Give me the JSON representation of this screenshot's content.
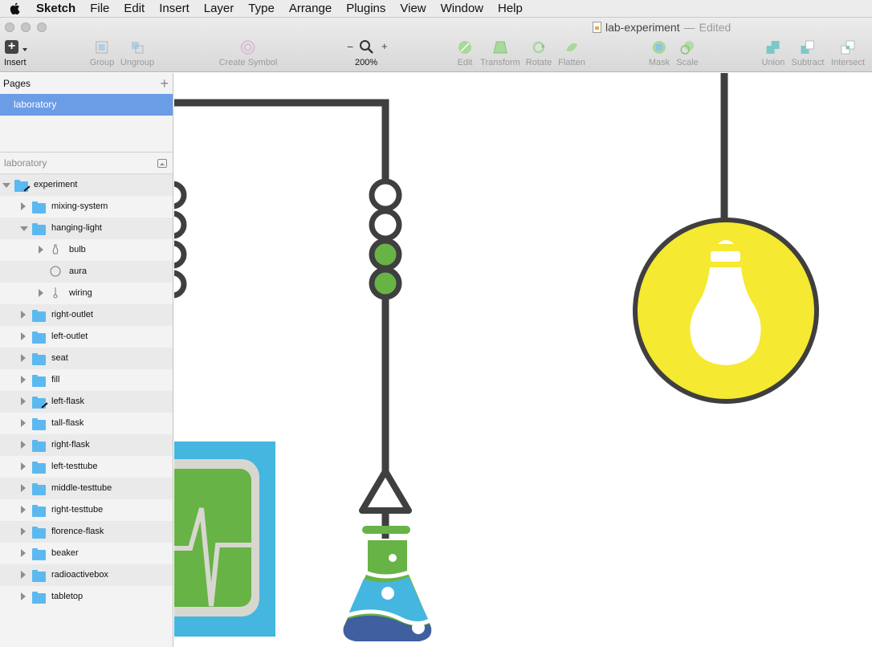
{
  "menubar": {
    "app_name": "Sketch",
    "items": [
      "File",
      "Edit",
      "Insert",
      "Layer",
      "Type",
      "Arrange",
      "Plugins",
      "View",
      "Window",
      "Help"
    ]
  },
  "window": {
    "doc_name": "lab-experiment",
    "separator": "—",
    "status": "Edited"
  },
  "toolbar": {
    "insert_label": "Insert",
    "group_label": "Group",
    "ungroup_label": "Ungroup",
    "create_symbol_label": "Create Symbol",
    "zoom_minus": "−",
    "zoom_plus": "+",
    "zoom_level": "200%",
    "edit_label": "Edit",
    "transform_label": "Transform",
    "rotate_label": "Rotate",
    "flatten_label": "Flatten",
    "mask_label": "Mask",
    "scale_label": "Scale",
    "union_label": "Union",
    "subtract_label": "Subtract",
    "intersect_label": "Intersect"
  },
  "pages": {
    "header": "Pages",
    "add": "+",
    "items": [
      "laboratory"
    ]
  },
  "layers": {
    "header": "laboratory",
    "items": [
      {
        "label": "experiment",
        "depth": 0,
        "expanded": true,
        "icon": "folder-masked"
      },
      {
        "label": "mixing-system",
        "depth": 1,
        "expanded": false,
        "icon": "folder"
      },
      {
        "label": "hanging-light",
        "depth": 1,
        "expanded": true,
        "icon": "folder"
      },
      {
        "label": "bulb",
        "depth": 2,
        "expanded": false,
        "icon": "bulb-shape"
      },
      {
        "label": "aura",
        "depth": 2,
        "expanded": null,
        "icon": "oval"
      },
      {
        "label": "wiring",
        "depth": 2,
        "expanded": false,
        "icon": "wiring-shape"
      },
      {
        "label": "right-outlet",
        "depth": 1,
        "expanded": false,
        "icon": "folder"
      },
      {
        "label": "left-outlet",
        "depth": 1,
        "expanded": false,
        "icon": "folder"
      },
      {
        "label": "seat",
        "depth": 1,
        "expanded": false,
        "icon": "folder"
      },
      {
        "label": "fill",
        "depth": 1,
        "expanded": false,
        "icon": "folder"
      },
      {
        "label": "left-flask",
        "depth": 1,
        "expanded": false,
        "icon": "folder-masked"
      },
      {
        "label": "tall-flask",
        "depth": 1,
        "expanded": false,
        "icon": "folder"
      },
      {
        "label": "right-flask",
        "depth": 1,
        "expanded": false,
        "icon": "folder"
      },
      {
        "label": "left-testtube",
        "depth": 1,
        "expanded": false,
        "icon": "folder"
      },
      {
        "label": "middle-testtube",
        "depth": 1,
        "expanded": false,
        "icon": "folder"
      },
      {
        "label": "right-testtube",
        "depth": 1,
        "expanded": false,
        "icon": "folder"
      },
      {
        "label": "florence-flask",
        "depth": 1,
        "expanded": false,
        "icon": "folder"
      },
      {
        "label": "beaker",
        "depth": 1,
        "expanded": false,
        "icon": "folder"
      },
      {
        "label": "radioactivebox",
        "depth": 1,
        "expanded": false,
        "icon": "folder"
      },
      {
        "label": "tabletop",
        "depth": 1,
        "expanded": false,
        "icon": "folder"
      }
    ]
  },
  "colors": {
    "selection": "#6b9ce6",
    "folder": "#5cb9f0",
    "wire": "#3f3f3f",
    "bulb_yellow": "#f5e931",
    "green": "#67b346",
    "blue_light": "#45b6e0",
    "blue_dark": "#3f5f9f"
  }
}
